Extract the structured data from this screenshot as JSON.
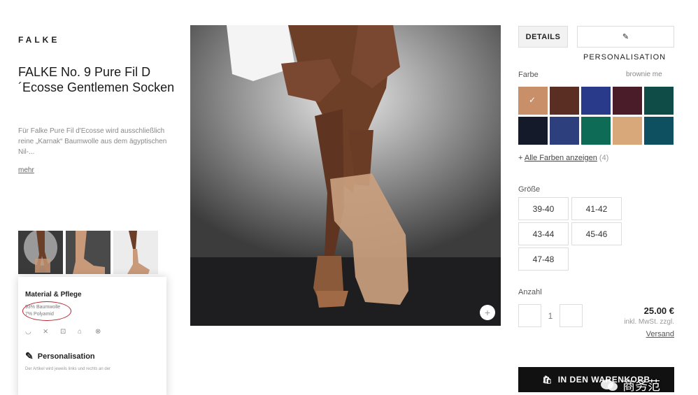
{
  "brand": "FALKE",
  "product": {
    "title": "FALKE No. 9 Pure Fil D ´Ecosse Gentlemen Socken",
    "description": "Für Falke Pure Fil d'Ecosse wird ausschließlich reine „Karnak“ Baumwolle aus dem ägyptischen Nil-...",
    "more_label": "mehr"
  },
  "thumbnails": [
    {
      "name": "thumb-1"
    },
    {
      "name": "thumb-2"
    },
    {
      "name": "thumb-3"
    }
  ],
  "material_card": {
    "title": "Material & Pflege",
    "lines": [
      "93% Baumwolle",
      "7% Polyamid"
    ],
    "personalisation_title": "Personalisation",
    "personalisation_text": "Der Artikel wird jeweils links und rechts an der"
  },
  "tabs": {
    "details": "DETAILS",
    "personalisation": "PERSONALISATION"
  },
  "color": {
    "label": "Farbe",
    "selected": "brownie me",
    "swatches": [
      "#c98f68",
      "#5a2e23",
      "#2a3a8a",
      "#4a1c2a",
      "#0f4c47",
      "#151a2a",
      "#2d3f7d",
      "#0d6b56",
      "#d8a87a",
      "#0f5060"
    ],
    "all_colors_label": "Alle Farben anzeigen",
    "all_colors_count": "(4)"
  },
  "size": {
    "label": "Größe",
    "options": [
      "39-40",
      "41-42",
      "43-44",
      "45-46",
      "47-48"
    ]
  },
  "quantity": {
    "label": "Anzahl",
    "value": "1"
  },
  "price": {
    "amount": "25.00 €",
    "tax": "inkl. MwSt. zzgl.",
    "shipping": "Versand"
  },
  "cart_button": "IN DEN WARENKORB",
  "watermark": "商务范"
}
